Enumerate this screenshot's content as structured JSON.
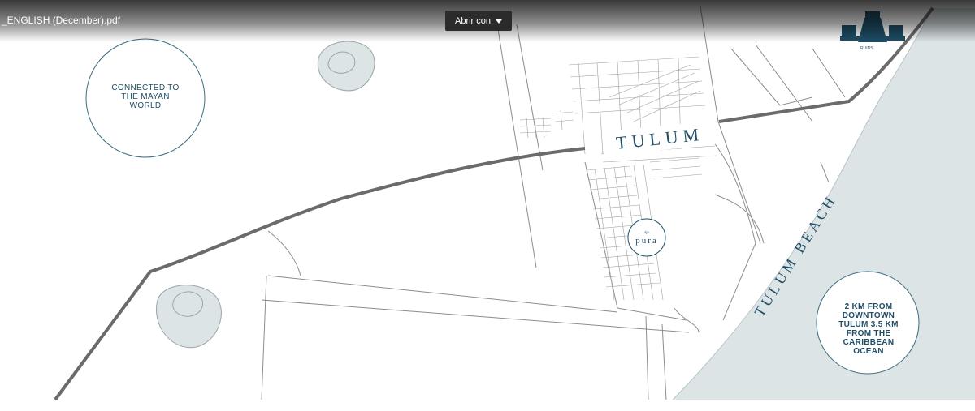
{
  "viewer": {
    "filename": "_ENGLISH (December).pdf",
    "open_with_label": "Abrir con"
  },
  "map": {
    "city_label": "TULUM",
    "beach_label": "TULUM BEACH",
    "ruins_label": "RUINS",
    "brand_small": "aje",
    "brand_name": "pura",
    "left_circle_text": "CONNECTED TO THE MAYAN WORLD",
    "right_circle_text": "2 KM FROM DOWNTOWN TULUM 3.5 KM FROM THE CARIBBEAN OCEAN",
    "colors": {
      "ink": "#1f4e66",
      "ocean": "#dce4e6",
      "road": "#6b6b6b",
      "street": "#9a9a9a"
    }
  }
}
